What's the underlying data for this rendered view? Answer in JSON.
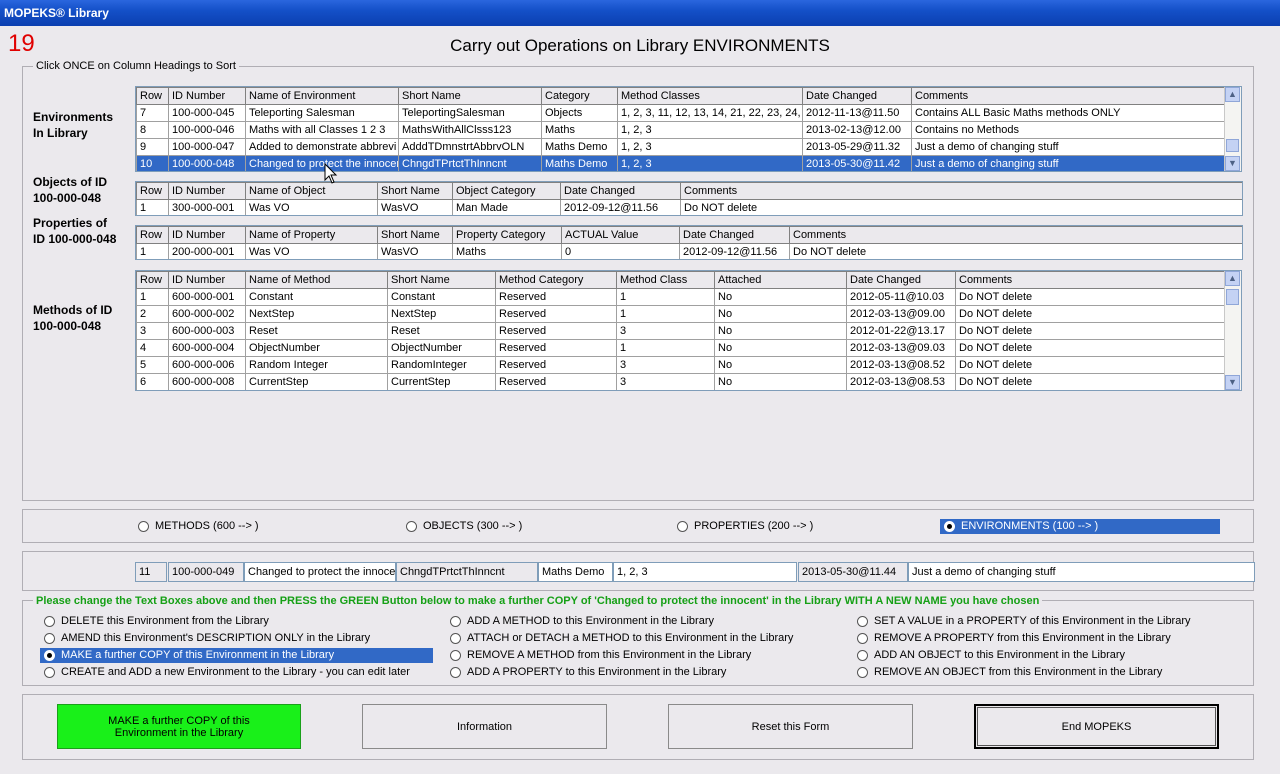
{
  "window": {
    "title": "MOPEKS® Library"
  },
  "page_number": "19",
  "heading": "Carry out Operations on Library ENVIRONMENTS",
  "sort_hint": "Click ONCE on Column Headings to Sort",
  "environments": {
    "label_line1": "Environments",
    "label_line2": "In Library",
    "columns": [
      "Row",
      "ID Number",
      "Name of Environment",
      "Short Name",
      "Category",
      "Method Classes",
      "Date Changed",
      "Comments"
    ],
    "rows": [
      [
        "7",
        "100-000-045",
        "Teleporting Salesman",
        "TeleportingSalesman",
        "Objects",
        "1, 2, 3, 11, 12, 13, 14, 21, 22, 23, 24,",
        "2012-11-13@11.50",
        "Contains ALL Basic Maths methods ONLY"
      ],
      [
        "8",
        "100-000-046",
        "Maths with all Classes 1 2 3",
        "MathsWithAllClsss123",
        "Maths",
        "1, 2, 3",
        "2013-02-13@12.00",
        "Contains no Methods"
      ],
      [
        "9",
        "100-000-047",
        "Added to demonstrate abbrevi",
        "AdddTDmnstrtAbbrvOLN",
        "Maths Demo",
        "1, 2, 3",
        "2013-05-29@11.32",
        "Just a demo of changing stuff"
      ],
      [
        "10",
        "100-000-048",
        "Changed to protect the innocen",
        "ChngdTPrtctThInncnt",
        "Maths Demo",
        "1, 2, 3",
        "2013-05-30@11.42",
        "Just a demo of changing stuff"
      ]
    ],
    "selected_row": 3
  },
  "objects": {
    "label_line1": "Objects of ID",
    "label_line2": "100-000-048",
    "columns": [
      "Row",
      "ID Number",
      "Name of Object",
      "Short Name",
      "Object Category",
      "Date Changed",
      "Comments"
    ],
    "rows": [
      [
        "1",
        "300-000-001",
        "Was VO",
        "WasVO",
        "Man Made",
        "2012-09-12@11.56",
        "Do NOT delete"
      ]
    ]
  },
  "properties": {
    "label_line1": "Properties of",
    "label_line2": "ID 100-000-048",
    "columns": [
      "Row",
      "ID Number",
      "Name of Property",
      "Short Name",
      "Property Category",
      "ACTUAL Value",
      "Date Changed",
      "Comments"
    ],
    "rows": [
      [
        "1",
        "200-000-001",
        "Was VO",
        "WasVO",
        "Maths",
        "0",
        "2012-09-12@11.56",
        "Do NOT delete"
      ]
    ]
  },
  "methods": {
    "label_line1": "Methods of ID",
    "label_line2": "100-000-048",
    "columns": [
      "Row",
      "ID Number",
      "Name of Method",
      "Short Name",
      "Method Category",
      "Method Class",
      "Attached",
      "Date Changed",
      "Comments"
    ],
    "rows": [
      [
        "1",
        "600-000-001",
        "Constant",
        "Constant",
        "Reserved",
        "1",
        "No",
        "2012-05-11@10.03",
        "Do NOT delete"
      ],
      [
        "2",
        "600-000-002",
        "NextStep",
        "NextStep",
        "Reserved",
        "1",
        "No",
        "2012-03-13@09.00",
        "Do NOT delete"
      ],
      [
        "3",
        "600-000-003",
        "Reset",
        "Reset",
        "Reserved",
        "3",
        "No",
        "2012-01-22@13.17",
        "Do NOT delete"
      ],
      [
        "4",
        "600-000-004",
        "ObjectNumber",
        "ObjectNumber",
        "Reserved",
        "1",
        "No",
        "2012-03-13@09.03",
        "Do NOT delete"
      ],
      [
        "5",
        "600-000-006",
        "Random Integer",
        "RandomInteger",
        "Reserved",
        "3",
        "No",
        "2012-03-13@08.52",
        "Do NOT delete"
      ],
      [
        "6",
        "600-000-008",
        "CurrentStep",
        "CurrentStep",
        "Reserved",
        "3",
        "No",
        "2012-03-13@08.53",
        "Do NOT delete"
      ]
    ]
  },
  "type_selector": {
    "options": [
      "METHODS (600 --> )",
      "OBJECTS (300 --> )",
      "PROPERTIES (200 --> )",
      "ENVIRONMENTS (100 --> )"
    ],
    "selected": 3
  },
  "edit_row": {
    "row": "11",
    "id": "100-000-049",
    "name": "Changed to protect the innocen",
    "short_name": "ChngdTPrtctThInncnt",
    "category": "Maths Demo",
    "method_classes": "1, 2, 3",
    "date_changed": "2013-05-30@11.44",
    "comments": "Just a demo of changing stuff"
  },
  "instruction": "Please change the Text Boxes above and then PRESS the GREEN Button below to make a further COPY of 'Changed to protect the innocent' in the Library WITH A NEW NAME you have chosen",
  "operations": {
    "col1": [
      "DELETE this Environment from the Library",
      "AMEND this Environment's DESCRIPTION ONLY in the Library",
      "MAKE a further COPY of this Environment in the Library",
      "CREATE and ADD a new Environment to the Library - you can edit later"
    ],
    "col2": [
      "ADD A METHOD to this Environment in the Library",
      "ATTACH or DETACH a METHOD to this Environment in the Library",
      "REMOVE A METHOD from this Environment in the Library",
      "ADD A PROPERTY to this Environment in the Library"
    ],
    "col3": [
      "SET A VALUE in a PROPERTY of this Environment in the Library",
      "REMOVE A PROPERTY from this Environment in the Library",
      "ADD AN OBJECT to this Environment in the Library",
      "REMOVE  AN OBJECT from this Environment in the Library"
    ],
    "selected": "MAKE a further COPY of this Environment in the Library"
  },
  "buttons": {
    "primary_line1": "MAKE a further COPY of this",
    "primary_line2": "Environment in the Library",
    "information": "Information",
    "reset": "Reset this Form",
    "end": "End MOPEKS"
  },
  "colors": {
    "selection": "#3169c6",
    "green_button": "#19f019",
    "page_number": "#e00000",
    "instruction": "#16a016"
  }
}
